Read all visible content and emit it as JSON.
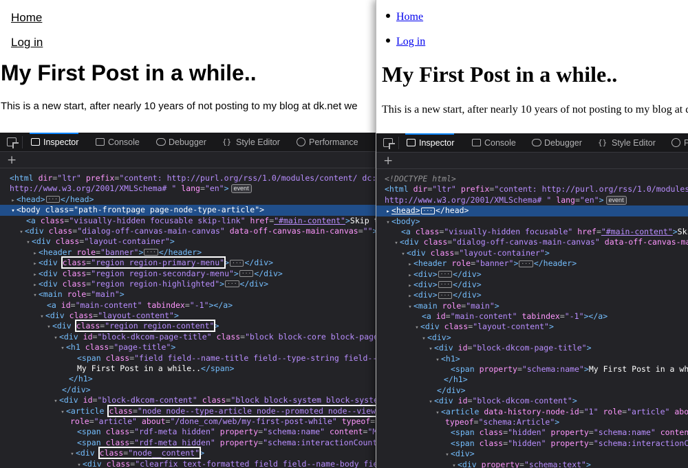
{
  "left": {
    "page": {
      "nav_home": "Home",
      "nav_login": "Log in",
      "title": "My First Post in a while..",
      "body": "This is a new start, after nearly 10 years of not posting to my blog at dk.net we"
    },
    "tabs": [
      "Inspector",
      "Console",
      "Debugger",
      "Style Editor",
      "Performance"
    ],
    "active_tab": "Inspector"
  },
  "right": {
    "page": {
      "nav_home": "Home",
      "nav_login": "Log in",
      "title": "My First Post in a while..",
      "body": "This is a new start, after nearly 10 years of not posting to my blog at d"
    },
    "tabs": [
      "Inspector",
      "Console",
      "Debugger",
      "Style Editor",
      "P"
    ],
    "active_tab": "Inspector"
  },
  "colors": {
    "devtools_bg": "#232327",
    "tab_bg": "#18181a",
    "accent": "#0a84ff",
    "selected_row": "#204e8a",
    "tag": "#75bfff",
    "attr": "#ff97fe",
    "value": "#b98eff"
  },
  "icons": [
    "element-picker-icon",
    "inspector-icon",
    "console-icon",
    "debugger-icon",
    "style-editor-icon",
    "performance-icon",
    "plus-icon"
  ]
}
